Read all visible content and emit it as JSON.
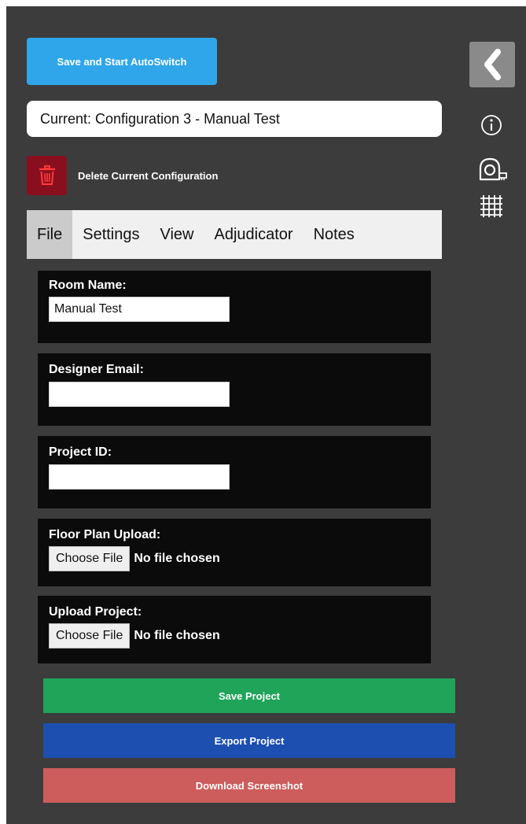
{
  "toolbar": {
    "save_autoswitch_label": "Save and Start AutoSwitch",
    "current_config": "Current: Configuration 3 - Manual Test",
    "delete_label": "Delete Current Configuration"
  },
  "tabs": [
    {
      "label": "File",
      "active": true
    },
    {
      "label": "Settings",
      "active": false
    },
    {
      "label": "View",
      "active": false
    },
    {
      "label": "Adjudicator",
      "active": false
    },
    {
      "label": "Notes",
      "active": false
    }
  ],
  "form": {
    "room_name": {
      "label": "Room Name:",
      "value": "Manual Test"
    },
    "designer_email": {
      "label": "Designer Email:",
      "value": ""
    },
    "project_id": {
      "label": "Project ID:",
      "value": ""
    },
    "floor_plan": {
      "label": "Floor Plan Upload:",
      "button": "Choose File",
      "status": "No file chosen"
    },
    "upload_project": {
      "label": "Upload Project:",
      "button": "Choose File",
      "status": "No file chosen"
    }
  },
  "actions": {
    "save": "Save Project",
    "export": "Export Project",
    "download": "Download Screenshot"
  },
  "sidebar_icons": [
    "chevron-left-icon",
    "info-icon",
    "tape-measure-icon",
    "grid-icon"
  ],
  "colors": {
    "panel_bg": "#3c3c3c",
    "autoswitch": "#2fa6ea",
    "delete": "#8a0f1e",
    "save": "#1fa45a",
    "export": "#1c4fb0",
    "download": "#cd5c5c"
  }
}
